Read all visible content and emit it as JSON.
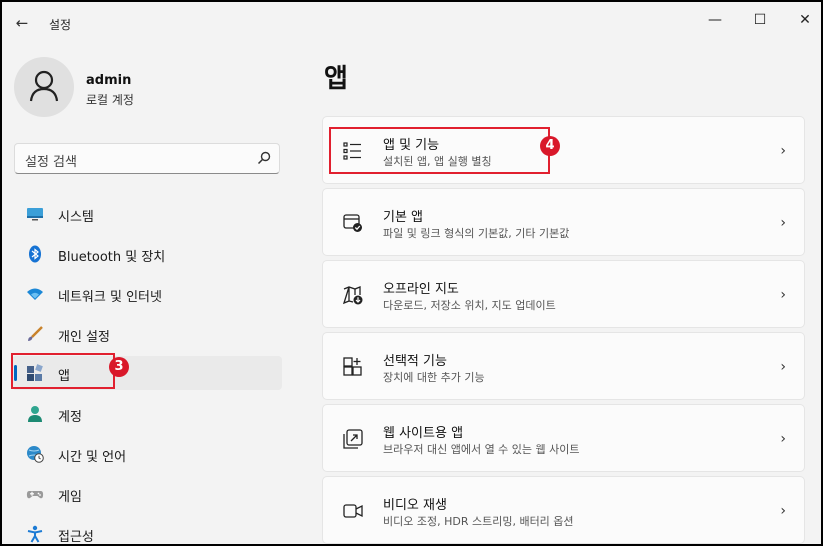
{
  "window": {
    "title": "설정",
    "controls": {
      "minimize": "—",
      "maximize": "☐",
      "close": "✕"
    }
  },
  "user": {
    "name": "admin",
    "account_type": "로컬 계정"
  },
  "search": {
    "placeholder": "설정 검색"
  },
  "sidebar": {
    "items": [
      {
        "label": "시스템",
        "icon": "monitor-icon"
      },
      {
        "label": "Bluetooth 및 장치",
        "icon": "bluetooth-icon"
      },
      {
        "label": "네트워크 및 인터넷",
        "icon": "wifi-icon"
      },
      {
        "label": "개인 설정",
        "icon": "brush-icon"
      },
      {
        "label": "앱",
        "icon": "apps-icon",
        "selected": true
      },
      {
        "label": "계정",
        "icon": "person-icon"
      },
      {
        "label": "시간 및 언어",
        "icon": "globe-clock-icon"
      },
      {
        "label": "게임",
        "icon": "gamepad-icon"
      },
      {
        "label": "접근성",
        "icon": "accessibility-icon"
      }
    ]
  },
  "annotations": {
    "badge_apps": "3",
    "badge_features": "4",
    "highlight_color": "#e1202f"
  },
  "main": {
    "title": "앱",
    "cards": [
      {
        "title": "앱 및 기능",
        "desc": "설치된 앱, 앱 실행 별칭",
        "icon": "list-icon"
      },
      {
        "title": "기본 앱",
        "desc": "파일 및 링크 형식의 기본값, 기타 기본값",
        "icon": "default-apps-icon"
      },
      {
        "title": "오프라인 지도",
        "desc": "다운로드, 저장소 위치, 지도 업데이트",
        "icon": "map-download-icon"
      },
      {
        "title": "선택적 기능",
        "desc": "장치에 대한 추가 기능",
        "icon": "add-grid-icon"
      },
      {
        "title": "웹 사이트용 앱",
        "desc": "브라우저 대신 앱에서 열 수 있는 웹 사이트",
        "icon": "open-link-icon"
      },
      {
        "title": "비디오 재생",
        "desc": "비디오 조정, HDR 스트리밍, 배터리 옵션",
        "icon": "video-icon"
      }
    ]
  },
  "colors": {
    "accent": "#0067c0",
    "window_bg": "#f3f3f3",
    "card_bg": "#fbfbfb"
  }
}
